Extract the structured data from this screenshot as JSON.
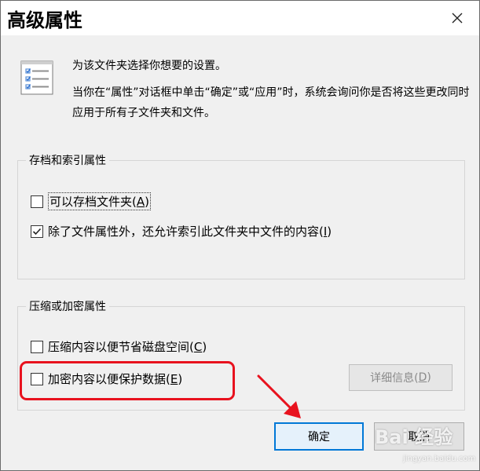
{
  "window": {
    "title": "高级属性",
    "close_glyph": "✕"
  },
  "header": {
    "line1": "为该文件夹选择你想要的设置。",
    "line2": "当你在“属性”对话框中单击“确定”或“应用”时，系统会询问你是否将这些更改同时应用于所有子文件夹和文件。"
  },
  "archive_group": {
    "title": "存档和索引属性",
    "items": [
      {
        "label": "可以存档文件夹(",
        "mnemonic": "A",
        "suffix": ")",
        "checked": false
      },
      {
        "label": "除了文件属性外，还允许索引此文件夹中文件的内容(",
        "mnemonic": "I",
        "suffix": ")",
        "checked": true
      }
    ]
  },
  "compress_group": {
    "title": "压缩或加密属性",
    "items": [
      {
        "label": "压缩内容以便节省磁盘空间(",
        "mnemonic": "C",
        "suffix": ")",
        "checked": false
      },
      {
        "label": "加密内容以便保护数据(",
        "mnemonic": "E",
        "suffix": ")",
        "checked": false
      }
    ],
    "details_button": {
      "label": "详细信息(",
      "mnemonic": "D",
      "suffix": ")",
      "enabled": false
    }
  },
  "footer": {
    "ok_label": "确定",
    "cancel_label": "取消"
  },
  "watermark": {
    "text": "Bai 经验",
    "url": "jingyan.baidu.com"
  },
  "icons": {
    "header": "properties-list-icon",
    "close": "close-icon",
    "checkmark": "checkmark-icon"
  },
  "colors": {
    "accent": "#0078d7",
    "annotation": "#e8121e",
    "dialog_bg": "#f0f0f0"
  }
}
